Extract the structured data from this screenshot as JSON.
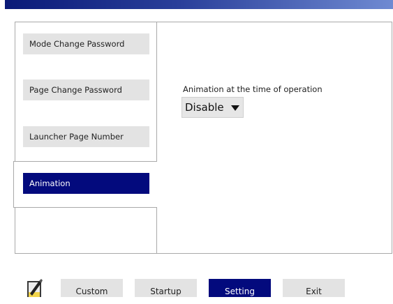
{
  "sidebar": {
    "items": [
      {
        "label": "Mode Change Password"
      },
      {
        "label": "Page Change Password"
      },
      {
        "label": "Launcher Page Number"
      },
      {
        "label": "Animation"
      }
    ]
  },
  "main": {
    "setting_label": "Animation at the time of operation",
    "dropdown_value": "Disable"
  },
  "footer": {
    "buttons": [
      {
        "label": "Custom"
      },
      {
        "label": "Startup"
      },
      {
        "label": "Setting"
      },
      {
        "label": "Exit"
      }
    ],
    "icon": "edit-pencil-icon"
  },
  "colors": {
    "accent": "#030a7d",
    "button_bg": "#e3e3e3"
  }
}
